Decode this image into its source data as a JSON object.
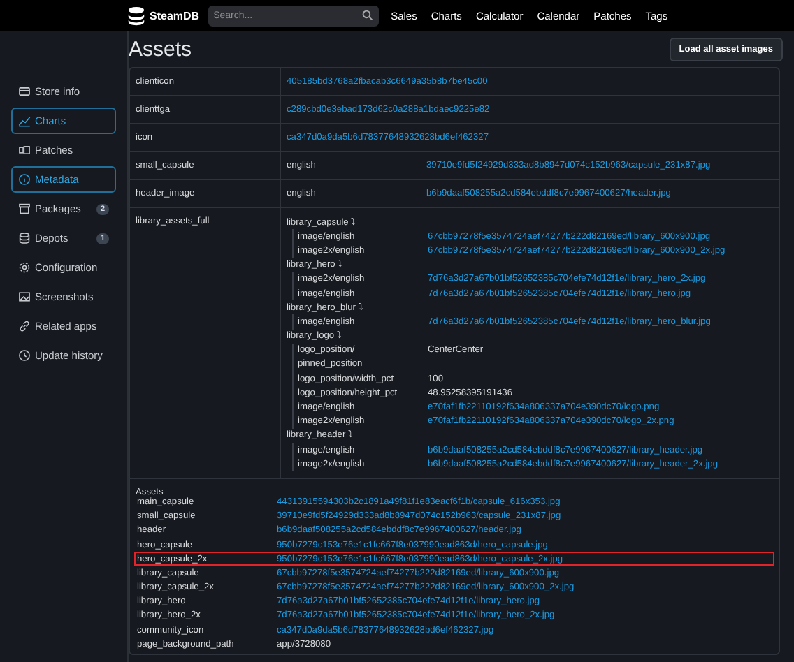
{
  "top_bar": {
    "logo": "SteamDB",
    "search": {
      "placeholder": "Search..."
    },
    "nav": [
      "Sales",
      "Charts",
      "Calculator",
      "Calendar",
      "Patches",
      "Tags"
    ]
  },
  "sidebar": {
    "items": [
      {
        "label": "Store info",
        "selected": false
      },
      {
        "label": "Charts",
        "selected": true
      },
      {
        "label": "Patches",
        "selected": false
      },
      {
        "label": "Metadata",
        "selected": true
      },
      {
        "label": "Packages",
        "selected": false,
        "badge": "2"
      },
      {
        "label": "Depots",
        "selected": false,
        "badge": "1"
      },
      {
        "label": "Configuration",
        "selected": false
      },
      {
        "label": "Screenshots",
        "selected": false
      },
      {
        "label": "Related apps",
        "selected": false
      },
      {
        "label": "Update history",
        "selected": false
      }
    ]
  },
  "page": {
    "title": "Assets",
    "button": "Load all asset images"
  },
  "table": {
    "rows": [
      {
        "kind": "single",
        "key": "clienticon",
        "value": "405185bd3768a2fbacab3c6649a35b8b7be45c00"
      },
      {
        "kind": "single",
        "key": "clienttga",
        "value": "c289cbd0e3ebad173d62c0a288a1bdaec9225e82"
      },
      {
        "kind": "single",
        "key": "icon",
        "value": "ca347d0a9da5b6d78377648932628bd6ef462327"
      },
      {
        "kind": "pair",
        "key": "small_capsule",
        "label": "english",
        "value": "39710e9fd5f24929d333ad8b8947d074c152b963/capsule_231x87.jpg"
      },
      {
        "kind": "pair",
        "key": "header_image",
        "label": "english",
        "value": "b6b9daaf508255a2cd584ebddf8c7e9967400627/header.jpg"
      },
      {
        "kind": "tree",
        "key": "library_assets_full",
        "groups": [
          {
            "name": "library_capsule",
            "expander": "⤵",
            "children": [
              {
                "name": "image/english",
                "value": "67cbb97278f5e3574724aef74277b222d82169ed/library_600x900.jpg",
                "link": true
              },
              {
                "name": "image2x/english",
                "value": "67cbb97278f5e3574724aef74277b222d82169ed/library_600x900_2x.jpg",
                "link": true
              }
            ]
          },
          {
            "name": "library_hero",
            "expander": "⤵",
            "children": [
              {
                "name": "image2x/english",
                "value": "7d76a3d27a67b01bf52652385c704efe74d12f1e/library_hero_2x.jpg",
                "link": true
              },
              {
                "name": "image/english",
                "value": "7d76a3d27a67b01bf52652385c704efe74d12f1e/library_hero.jpg",
                "link": true
              }
            ]
          },
          {
            "name": "library_hero_blur",
            "expander": "⤵",
            "children": [
              {
                "name": "image/english",
                "value": "7d76a3d27a67b01bf52652385c704efe74d12f1e/library_hero_blur.jpg",
                "link": true
              }
            ]
          },
          {
            "name": "library_logo",
            "expander": "⤵",
            "children": [
              {
                "name": "logo_position/",
                "value": "CenterCenter",
                "link": false
              },
              {
                "name": "pinned_position"
              },
              {
                "name": "logo_position/width_pct",
                "value": "100",
                "link": false
              },
              {
                "name": "logo_position/height_pct",
                "value": "48.95258395191436",
                "link": false
              },
              {
                "name": "image/english",
                "value": "e70faf1fb22110192f634a806337a704e390dc70/logo.png",
                "link": true
              },
              {
                "name": "image2x/english",
                "value": "e70faf1fb22110192f634a806337a704e390dc70/logo_2x.png",
                "link": true
              }
            ]
          },
          {
            "name": "library_header",
            "expander": "⤵",
            "children": [
              {
                "name": "image/english",
                "value": "b6b9daaf508255a2cd584ebddf8c7e9967400627/library_header.jpg",
                "link": true
              },
              {
                "name": "image2x/english",
                "value": "b6b9daaf508255a2cd584ebddf8c7e9967400627/library_header_2x.jpg",
                "link": true
              }
            ]
          }
        ]
      },
      {
        "kind": "list",
        "key": "Assets",
        "items": [
          {
            "name": "main_capsule",
            "value": "44313915594303b2c1891a49f81f1e83eacf6f1b/capsule_616x353.jpg",
            "link": true,
            "highlighted": false
          },
          {
            "name": "small_capsule",
            "value": "39710e9fd5f24929d333ad8b8947d074c152b963/capsule_231x87.jpg",
            "link": true,
            "highlighted": false
          },
          {
            "name": "header",
            "value": "b6b9daaf508255a2cd584ebddf8c7e9967400627/header.jpg",
            "link": true,
            "highlighted": false
          },
          {
            "name": "hero_capsule",
            "value": "950b7279c153e76e1c1fc667f8e037990ead863d/hero_capsule.jpg",
            "link": true,
            "highlighted": false
          },
          {
            "name": "hero_capsule_2x",
            "value": "950b7279c153e76e1c1fc667f8e037990ead863d/hero_capsule_2x.jpg",
            "link": true,
            "highlighted": true
          },
          {
            "name": "library_capsule",
            "value": "67cbb97278f5e3574724aef74277b222d82169ed/library_600x900.jpg",
            "link": true,
            "highlighted": false
          },
          {
            "name": "library_capsule_2x",
            "value": "67cbb97278f5e3574724aef74277b222d82169ed/library_600x900_2x.jpg",
            "link": true,
            "highlighted": false
          },
          {
            "name": "library_hero",
            "value": "7d76a3d27a67b01bf52652385c704efe74d12f1e/library_hero.jpg",
            "link": true,
            "highlighted": false
          },
          {
            "name": "library_hero_2x",
            "value": "7d76a3d27a67b01bf52652385c704efe74d12f1e/library_hero_2x.jpg",
            "link": true,
            "highlighted": false
          },
          {
            "name": "community_icon",
            "value": "ca347d0a9da5b6d78377648932628bd6ef462327.jpg",
            "link": true,
            "highlighted": false
          },
          {
            "name": "page_background_path",
            "value": "app/3728080",
            "link": false,
            "highlighted": false
          }
        ]
      }
    ]
  }
}
